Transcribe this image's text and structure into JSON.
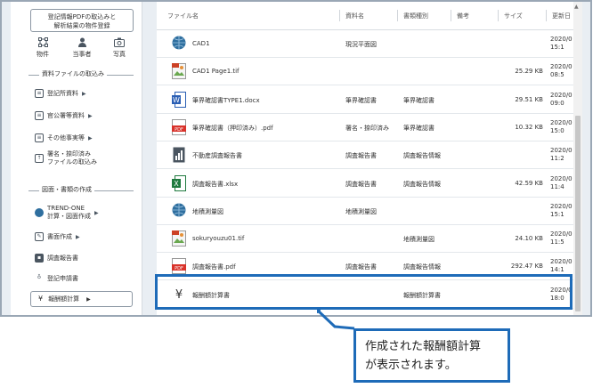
{
  "sidebar": {
    "import_button": [
      "登記情報PDFの取込みと",
      "解析結果の物件登録"
    ],
    "top_icons": [
      {
        "label": "物件",
        "icon": "network-icon"
      },
      {
        "label": "当事者",
        "icon": "person-icon"
      },
      {
        "label": "写真",
        "icon": "camera-icon"
      }
    ],
    "section1": "資料ファイルの取込み",
    "menu1": [
      "登記所資料",
      "官公署等資料",
      "その他事実等"
    ],
    "menu1_two": [
      "署名・捺印済み",
      "ファイルの取込み"
    ],
    "section2": "図面・書類の作成",
    "trend_one": [
      "TREND-ONE",
      "計算・図面作成"
    ],
    "menu2": [
      "書面作成",
      "調査報告書",
      "登記申請書"
    ],
    "fee_item": "報酬額計算"
  },
  "table": {
    "headers": [
      "ファイル名",
      "資料名",
      "書類種別",
      "備考",
      "サイズ",
      "更新日"
    ],
    "rows": [
      {
        "icon": "cad-globe-icon",
        "name": "CAD1",
        "material": "現況平面図",
        "doc_type": "",
        "size": "",
        "date": [
          "2020/0",
          "15:1"
        ]
      },
      {
        "icon": "tif-image-icon",
        "name": "CAD1 Page1.tif",
        "material": "",
        "doc_type": "",
        "size": "25.29 KB",
        "date": [
          "2020/0",
          "08:5"
        ]
      },
      {
        "icon": "word-icon",
        "name": "筆界確認書TYPE1.docx",
        "material": "筆界確認書",
        "doc_type": "筆界確認書",
        "size": "29.51 KB",
        "date": [
          "2020/0",
          "09:0"
        ]
      },
      {
        "icon": "pdf-icon",
        "name": "筆界確認書（押印済み）.pdf",
        "material": "署名・捺印済み",
        "doc_type": "筆界確認書",
        "size": "10.32 KB",
        "date": [
          "2020/0",
          "15:0"
        ]
      },
      {
        "icon": "report-chart-icon",
        "name": "不動産調査報告書",
        "material": "調査報告書",
        "doc_type": "調査報告情報",
        "size": "",
        "date": [
          "2020/0",
          "11:2"
        ]
      },
      {
        "icon": "excel-icon",
        "name": "調査報告書.xlsx",
        "material": "調査報告書",
        "doc_type": "調査報告情報",
        "size": "42.59 KB",
        "date": [
          "2020/0",
          "11:4"
        ]
      },
      {
        "icon": "cad-globe-icon",
        "name": "地積測量図",
        "material": "地積測量図",
        "doc_type": "",
        "size": "",
        "date": [
          "2020/0",
          "15:1"
        ]
      },
      {
        "icon": "tif-image-icon",
        "name": "sokuryouzu01.tif",
        "material": "",
        "doc_type": "地積測量図",
        "size": "24.10 KB",
        "date": [
          "2020/0",
          "11:5"
        ]
      },
      {
        "icon": "pdf-icon",
        "name": "調査報告書.pdf",
        "material": "調査報告書",
        "doc_type": "調査報告情報",
        "size": "292.47 KB",
        "date": [
          "2020/0",
          "14:1"
        ]
      },
      {
        "icon": "yen-icon",
        "name": "報酬額計算書",
        "material": "",
        "doc_type": "報酬額計算書",
        "size": "",
        "date": [
          "2020/0",
          "18:0"
        ]
      }
    ]
  },
  "callout": [
    "作成された報酬額計算",
    "が表示されます。"
  ],
  "colors": {
    "accent": "#1e6bb8",
    "pdf": "#d9332b",
    "word": "#2b5fb4",
    "excel": "#1f7a3f"
  }
}
